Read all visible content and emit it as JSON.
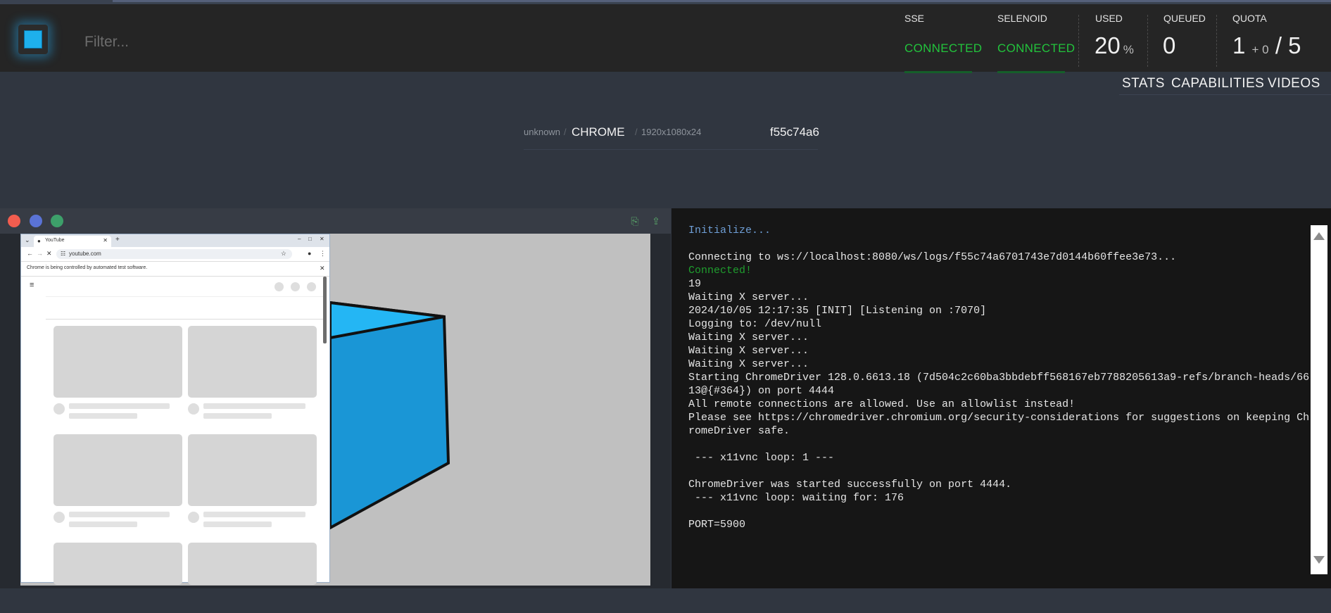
{
  "filter": {
    "placeholder": "Filter..."
  },
  "status": {
    "sse": {
      "label": "SSE",
      "value": "CONNECTED"
    },
    "selenoid": {
      "label": "SELENOID",
      "value": "CONNECTED"
    },
    "used": {
      "label": "USED",
      "value": "20",
      "unit": "%"
    },
    "queued": {
      "label": "QUEUED",
      "value": "0"
    },
    "quota": {
      "label": "QUOTA",
      "used": "1",
      "plus": "+ 0",
      "slash": "/",
      "total": "5"
    }
  },
  "nav": [
    "STATS",
    "CAPABILITIES",
    "VIDEOS"
  ],
  "session": {
    "platform": "unknown",
    "separator": "/",
    "browser": "CHROME",
    "resolution": "1920x1080x24",
    "id": "f55c74a6"
  },
  "vnc_browser": {
    "tab_title": "YouTube",
    "url": "youtube.com",
    "automation_notice": "Chrome is being controlled by automated test software."
  },
  "log": [
    {
      "text": "Initialize...",
      "color": "#6f9fd6"
    },
    {
      "text": "",
      "color": "#e6e6e6"
    },
    {
      "text": "Connecting to ws://localhost:8080/ws/logs/f55c74a6701743e7d0144b60ffee3e73...",
      "color": "#e6e6e6"
    },
    {
      "text": "Connected!",
      "color": "#1f9e2e"
    },
    {
      "text": "19",
      "color": "#e6e6e6"
    },
    {
      "text": "Waiting X server...",
      "color": "#e6e6e6"
    },
    {
      "text": "2024/10/05 12:17:35 [INIT] [Listening on :7070]",
      "color": "#e6e6e6"
    },
    {
      "text": "Logging to: /dev/null",
      "color": "#e6e6e6"
    },
    {
      "text": "Waiting X server...",
      "color": "#e6e6e6"
    },
    {
      "text": "Waiting X server...",
      "color": "#e6e6e6"
    },
    {
      "text": "Waiting X server...",
      "color": "#e6e6e6"
    },
    {
      "text": "Starting ChromeDriver 128.0.6613.18 (7d504c2c60ba3bbdebff568167eb7788205613a9-refs/branch-heads/66",
      "color": "#e6e6e6"
    },
    {
      "text": "13@{#364}) on port 4444",
      "color": "#e6e6e6"
    },
    {
      "text": "All remote connections are allowed. Use an allowlist instead!",
      "color": "#e6e6e6"
    },
    {
      "text": "Please see https://chromedriver.chromium.org/security-considerations for suggestions on keeping Ch",
      "color": "#e6e6e6"
    },
    {
      "text": "romeDriver safe.",
      "color": "#e6e6e6"
    },
    {
      "text": "",
      "color": "#e6e6e6"
    },
    {
      "text": " --- x11vnc loop: 1 ---",
      "color": "#e6e6e6"
    },
    {
      "text": "",
      "color": "#e6e6e6"
    },
    {
      "text": "ChromeDriver was started successfully on port 4444.",
      "color": "#e6e6e6"
    },
    {
      "text": " --- x11vnc loop: waiting for: 176",
      "color": "#e6e6e6"
    },
    {
      "text": "",
      "color": "#e6e6e6"
    },
    {
      "text": "PORT=5900",
      "color": "#e6e6e6"
    }
  ],
  "colors": {
    "connected": "#22c33c",
    "accent": "#1eb0ec",
    "dot_red": "#f25d4f",
    "dot_blue": "#5a73d6",
    "dot_green": "#3da06a"
  }
}
